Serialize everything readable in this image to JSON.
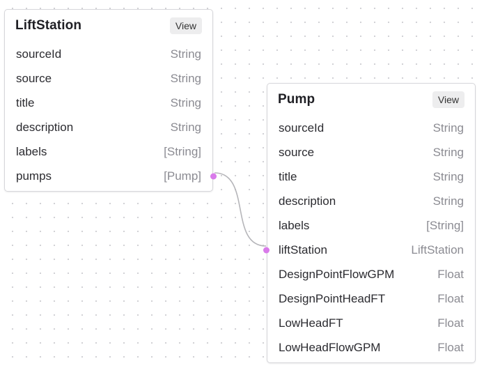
{
  "nodes": {
    "lift_station": {
      "title": "LiftStation",
      "view_label": "View",
      "fields": [
        {
          "name": "sourceId",
          "type": "String"
        },
        {
          "name": "source",
          "type": "String"
        },
        {
          "name": "title",
          "type": "String"
        },
        {
          "name": "description",
          "type": "String"
        },
        {
          "name": "labels",
          "type": "[String]"
        },
        {
          "name": "pumps",
          "type": "[Pump]"
        }
      ]
    },
    "pump": {
      "title": "Pump",
      "view_label": "View",
      "fields": [
        {
          "name": "sourceId",
          "type": "String"
        },
        {
          "name": "source",
          "type": "String"
        },
        {
          "name": "title",
          "type": "String"
        },
        {
          "name": "description",
          "type": "String"
        },
        {
          "name": "labels",
          "type": "[String]"
        },
        {
          "name": "liftStation",
          "type": "LiftStation"
        },
        {
          "name": "DesignPointFlowGPM",
          "type": "Float"
        },
        {
          "name": "DesignPointHeadFT",
          "type": "Float"
        },
        {
          "name": "LowHeadFT",
          "type": "Float"
        },
        {
          "name": "LowHeadFlowGPM",
          "type": "Float"
        }
      ]
    }
  },
  "edges": [
    {
      "from": "LiftStation.pumps",
      "to": "Pump.liftStation"
    }
  ],
  "colors": {
    "canvas_background": "#ffffff",
    "grid_dot": "#cfcfd4",
    "node_border": "#d6d6da",
    "handle": "#d97bea",
    "edge": "#b5b5b9",
    "view_button_bg": "#ededee",
    "field_type_text": "#8b8b92"
  }
}
